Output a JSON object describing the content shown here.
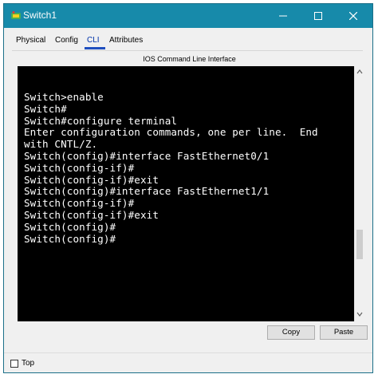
{
  "window": {
    "title": "Switch1",
    "accent_color": "#178aaa",
    "controls": [
      "minimize-icon",
      "maximize-icon",
      "close-icon"
    ]
  },
  "tabs": [
    {
      "label": "Physical"
    },
    {
      "label": "Config"
    },
    {
      "label": "CLI",
      "active": true
    },
    {
      "label": "Attributes"
    }
  ],
  "cli": {
    "panel_title": "IOS Command Line Interface",
    "lines": [
      "Switch>enable",
      "Switch#",
      "Switch#configure terminal",
      "Enter configuration commands, one per line.  End",
      "with CNTL/Z.",
      "Switch(config)#interface FastEthernet0/1",
      "Switch(config-if)#",
      "Switch(config-if)#exit",
      "Switch(config)#interface FastEthernet1/1",
      "Switch(config-if)#",
      "Switch(config-if)#exit",
      "Switch(config)#",
      "Switch(config)#"
    ],
    "copy_label": "Copy",
    "paste_label": "Paste"
  },
  "footer": {
    "top_label": "Top",
    "top_checked": false
  }
}
